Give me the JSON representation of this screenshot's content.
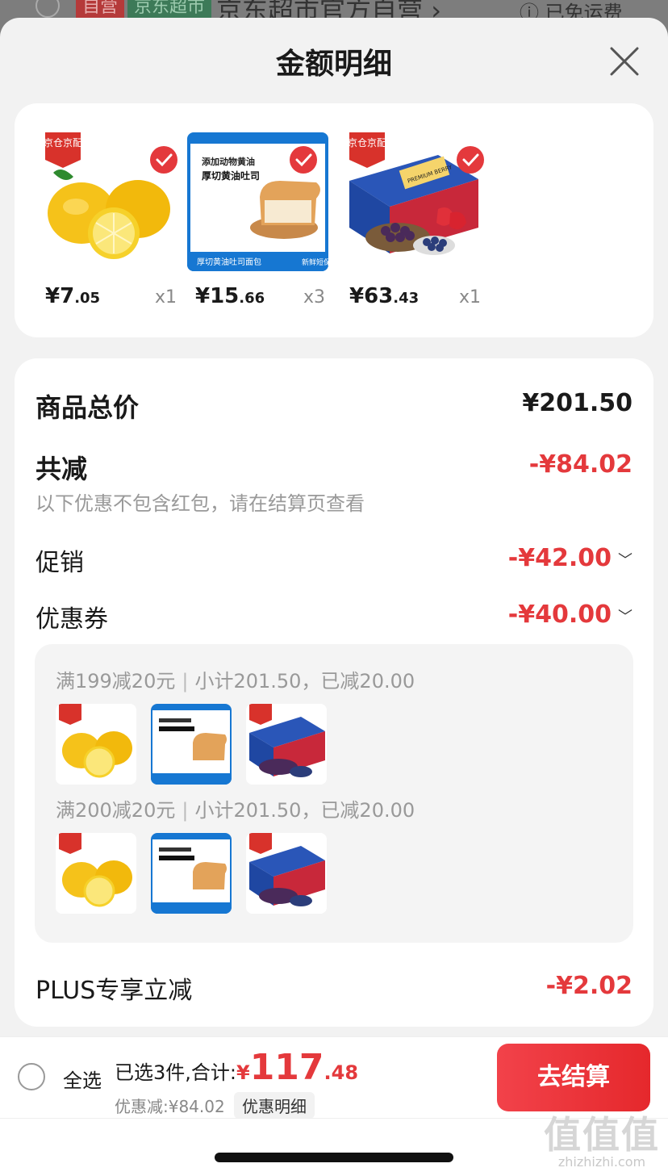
{
  "background": {
    "tag_self": "自营",
    "tag_store": "京东超市",
    "store_title": "京东超市官方自营",
    "free_shipping": "已免运费"
  },
  "sheet": {
    "title": "金额明细"
  },
  "products": [
    {
      "badge": "京仓京配",
      "price_int": "7",
      "price_dec": ".05",
      "qty": "x1",
      "selected": true,
      "kind": "lemon"
    },
    {
      "badge": "",
      "price_int": "15",
      "price_dec": ".66",
      "qty": "x3",
      "selected": true,
      "kind": "toast",
      "image_text": {
        "line1": "添加动物黄油",
        "line2": "厚切黄油吐司",
        "bottom": "厚切黄油吐司面包",
        "fresh": "新鲜短保"
      }
    },
    {
      "badge": "京仓京配",
      "price_int": "63",
      "price_dec": ".43",
      "qty": "x1",
      "selected": true,
      "kind": "berry",
      "image_text": {
        "box": "PREMIUM BERRY"
      }
    }
  ],
  "currency": "¥",
  "summary": {
    "total_label": "商品总价",
    "total_value": "¥201.50",
    "reduce_label": "共减",
    "reduce_value": "-¥84.02",
    "note": "以下优惠不包含红包，请在结算页查看",
    "promo_label": "促销",
    "promo_value": "-¥42.00",
    "coupon_label": "优惠券",
    "coupon_value": "-¥40.00",
    "plus_label": "PLUS专享立减",
    "plus_value": "-¥2.02"
  },
  "coupons": [
    {
      "rule": "满199减20元",
      "detail": "小计201.50，已减20.00"
    },
    {
      "rule": "满200减20元",
      "detail": "小计201.50，已减20.00"
    }
  ],
  "bottom_bar": {
    "select_all": "全选",
    "selected_text": "已选3件,合计:",
    "total_yen": "¥",
    "total_int": "117",
    "total_dec": ".48",
    "discount_text": "优惠减:¥84.02",
    "detail_chip": "优惠明细",
    "checkout": "去结算"
  },
  "watermark": {
    "logo": "值值值",
    "url": "zhizhizhi.com"
  },
  "colors": {
    "accent_red": "#e4393c",
    "badge_red": "#d8322b",
    "bread_blue": "#1677d2"
  }
}
